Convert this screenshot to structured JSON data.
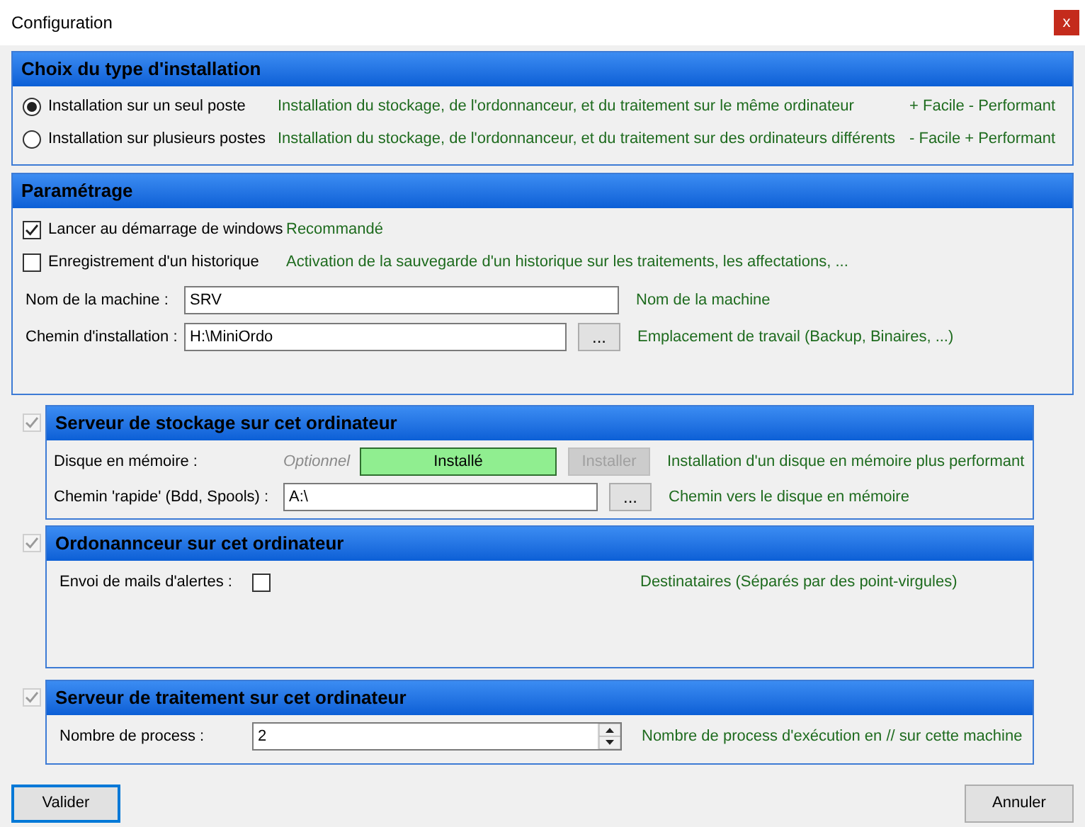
{
  "window": {
    "title": "Configuration",
    "close": "x"
  },
  "install_type": {
    "title": "Choix du type d'installation",
    "options": [
      {
        "label": "Installation sur un seul poste",
        "description": "Installation du stockage, de l'ordonnanceur, et du traitement sur le même ordinateur",
        "tradeoff": "+ Facile - Performant",
        "selected": true
      },
      {
        "label": "Installation sur plusieurs postes",
        "description": "Installation du stockage, de l'ordonnanceur, et du traitement sur des ordinateurs différents",
        "tradeoff": "- Facile + Performant",
        "selected": false
      }
    ]
  },
  "settings": {
    "title": "Paramétrage",
    "checkboxes": [
      {
        "label": "Lancer au démarrage de windows",
        "note": "Recommandé",
        "checked": true
      },
      {
        "label": "Enregistrement d'un historique",
        "note": "Activation de la sauvegarde d'un historique sur les traitements, les affectations, ...",
        "checked": false
      }
    ],
    "fields": [
      {
        "label": "Nom de la machine :",
        "value": "SRV",
        "note": "Nom de la machine"
      },
      {
        "label": "Chemin d'installation :",
        "value": "H:\\MiniOrdo",
        "browse": "...",
        "note": "Emplacement de travail (Backup, Binaires, ...)"
      }
    ]
  },
  "storage": {
    "title": "Serveur de stockage sur cet ordinateur",
    "checked": true,
    "disabled": true,
    "ram_disk": {
      "label": "Disque en mémoire :",
      "hint": "Optionnel",
      "status": "Installé",
      "install_button": "Installer",
      "install_disabled": true,
      "note": "Installation d'un disque en mémoire plus performant"
    },
    "fast_path": {
      "label": "Chemin 'rapide' (Bdd, Spools) :",
      "value": "A:\\",
      "browse": "...",
      "note": "Chemin vers le disque en mémoire"
    }
  },
  "scheduler": {
    "title": "Ordonannceur sur cet ordinateur",
    "checked": true,
    "disabled": true,
    "mail_alerts": {
      "label": "Envoi de mails d'alertes :",
      "checked": false,
      "note": "Destinataires (Séparés par des point-virgules)"
    }
  },
  "processing": {
    "title": "Serveur de traitement sur cet ordinateur",
    "checked": true,
    "disabled": true,
    "process_count": {
      "label": "Nombre de process :",
      "value": "2",
      "note": "Nombre de process d'exécution en // sur cette machine"
    }
  },
  "buttons": [
    {
      "label": "Valider",
      "default": true
    },
    {
      "label": "Annuler",
      "default": false
    }
  ]
}
